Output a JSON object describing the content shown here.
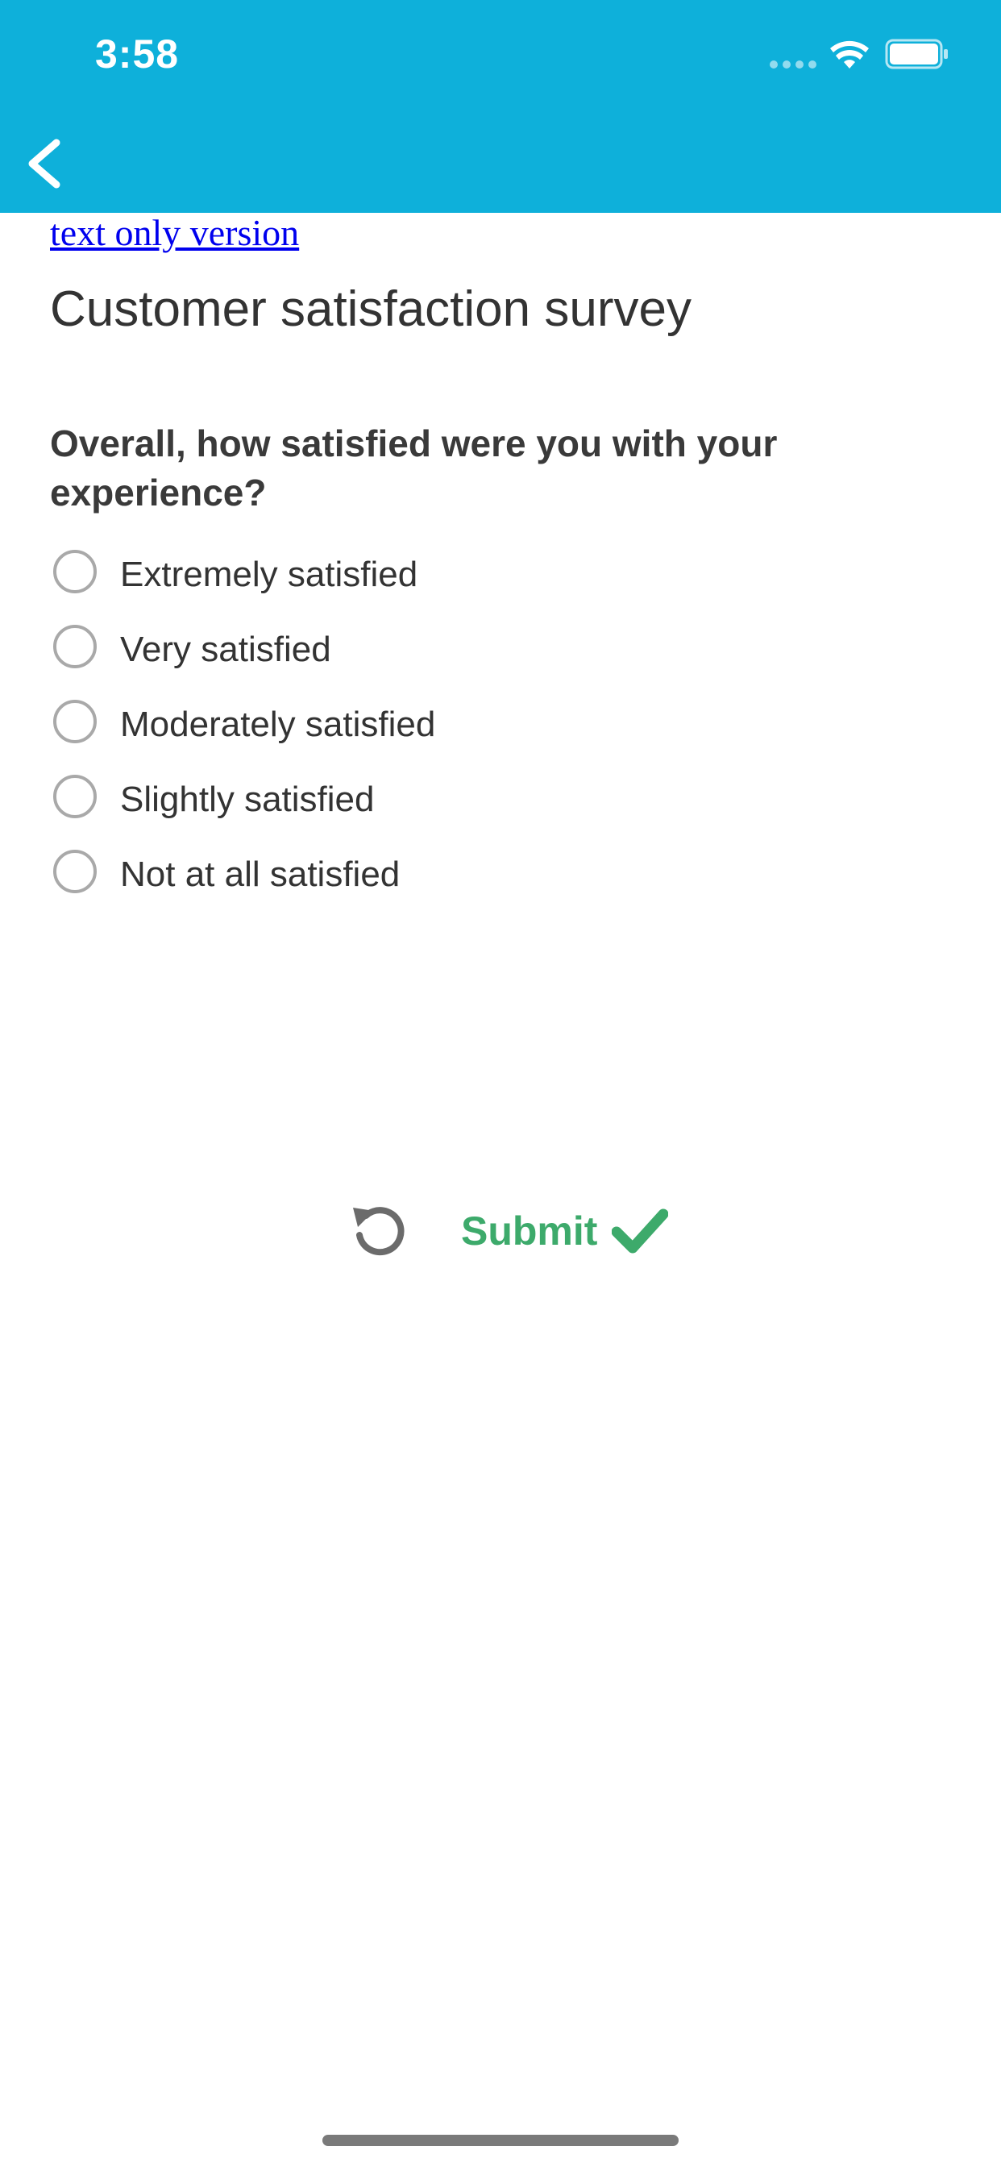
{
  "status_bar": {
    "time": "3:58",
    "icons": [
      "signal-dots-icon",
      "wifi-icon",
      "battery-icon"
    ]
  },
  "header": {
    "back_icon": "chevron-left-icon",
    "background_color": "#0eb0da"
  },
  "links": {
    "text_only": "text only version"
  },
  "page": {
    "title": "Customer satisfaction survey"
  },
  "survey": {
    "question": "Overall, how satisfied were you with your experience?",
    "options": [
      {
        "label": "Extremely satisfied",
        "selected": false
      },
      {
        "label": "Very satisfied",
        "selected": false
      },
      {
        "label": "Moderately satisfied",
        "selected": false
      },
      {
        "label": "Slightly satisfied",
        "selected": false
      },
      {
        "label": "Not at all satisfied",
        "selected": false
      }
    ]
  },
  "actions": {
    "reset_icon": "reset-icon",
    "submit_label": "Submit",
    "submit_icon": "check-icon",
    "submit_color": "#3daa6b"
  }
}
